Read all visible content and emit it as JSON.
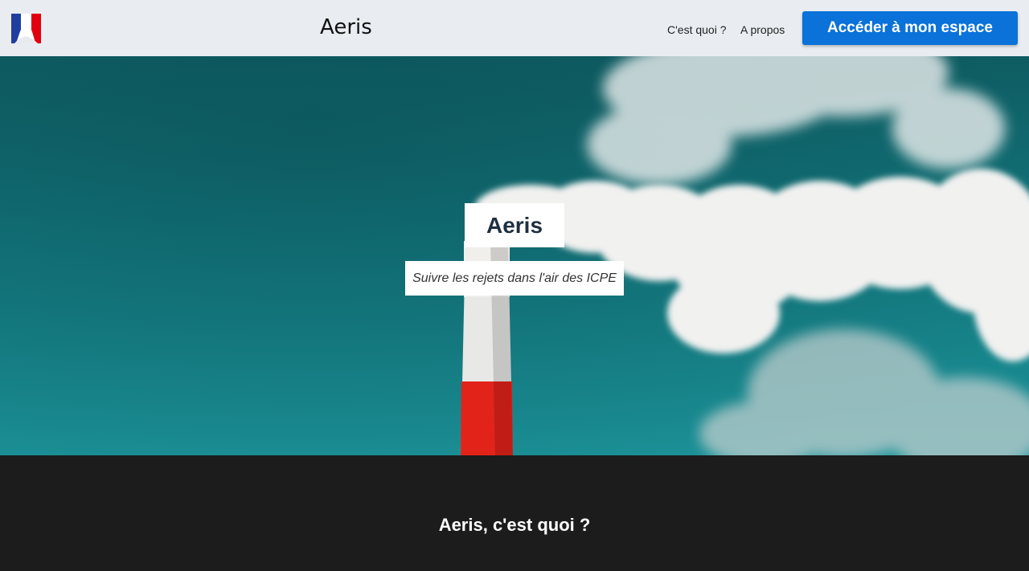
{
  "header": {
    "site_title": "Aeris",
    "nav": {
      "what_label": "C'est quoi ?",
      "about_label": "A propos"
    },
    "cta_label": "Accéder à mon espace"
  },
  "hero": {
    "title": "Aeris",
    "subtitle": "Suivre les rejets dans l'air des ICPE"
  },
  "section": {
    "heading": "Aeris, c'est quoi ?"
  },
  "colors": {
    "header_bg": "#e9edf2",
    "cta_bg": "#0a72d9",
    "sky": "#137a80",
    "chimney_red": "#e2231a",
    "dark_bg": "#1c1c1c"
  },
  "icons": {
    "logo": "marianne-logo-icon"
  }
}
